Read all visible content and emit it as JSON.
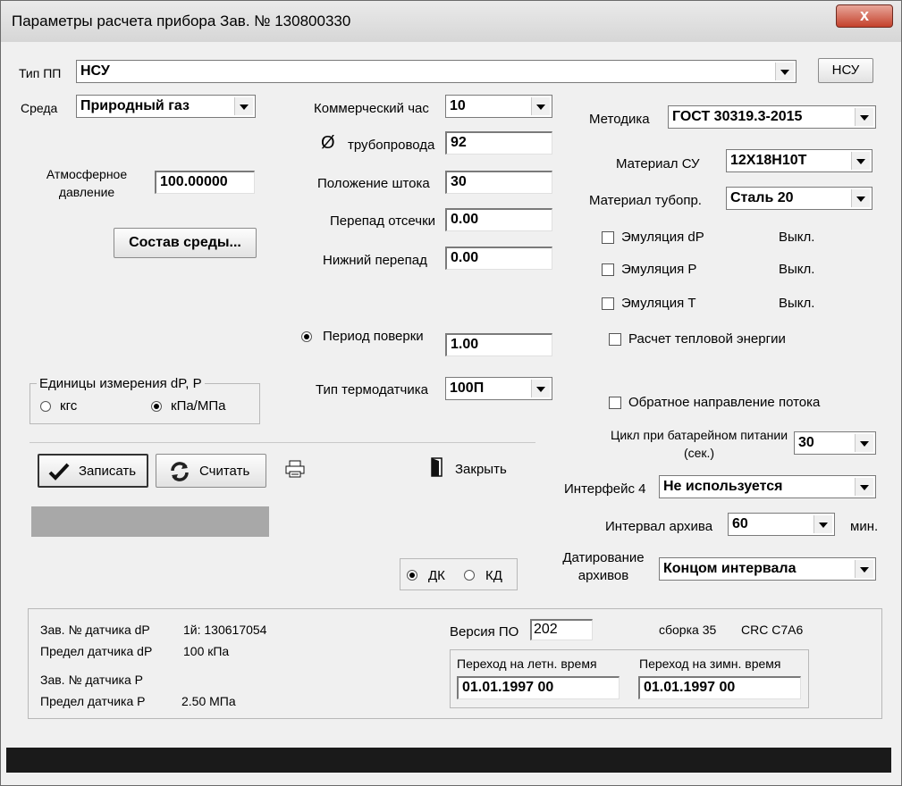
{
  "window": {
    "title": "Параметры расчета прибора  Зав. № 130800330",
    "close": "x"
  },
  "device_type": {
    "label": "Тип ПП",
    "value": "НСУ",
    "button": "НСУ"
  },
  "medium": {
    "label": "Среда",
    "value": "Природный газ"
  },
  "atm": {
    "label": "Атмосферное давление",
    "value": "100.00000"
  },
  "composition_button": "Состав среды...",
  "commercial_hour": {
    "label": "Коммерческий час",
    "value": "10"
  },
  "pipe": {
    "symbol": "Ø",
    "label": "трубопровода",
    "value": "92"
  },
  "stem": {
    "label": "Положение штока",
    "value": "30"
  },
  "cutoff": {
    "label": "Перепад отсечки",
    "value": "0.00"
  },
  "low_drop": {
    "label": "Нижний перепад",
    "value": "0.00"
  },
  "verification": {
    "label": "Период поверки",
    "value": "1.00"
  },
  "thermo": {
    "label": "Тип термодатчика",
    "value": "100П"
  },
  "units": {
    "legend": "Единицы измерения dP, P",
    "opt1": "кгс",
    "opt2": "кПа/МПа"
  },
  "method": {
    "label": "Методика",
    "value": "ГОСТ 30319.3-2015"
  },
  "su_material": {
    "label": "Материал СУ",
    "value": "12Х18Н10Т"
  },
  "pipe_material": {
    "label": "Материал тубопр.",
    "value": "Сталь 20"
  },
  "emulation": [
    {
      "label": "Эмуляция dP",
      "state": "Выкл."
    },
    {
      "label": "Эмуляция P",
      "state": "Выкл."
    },
    {
      "label": "Эмуляция T",
      "state": "Выкл."
    }
  ],
  "heat_energy": "Расчет тепловой энергии",
  "reverse_flow": "Обратное направление потока",
  "battery_cycle": {
    "label": "Цикл при батарейном питании (сек.)",
    "value": "30"
  },
  "interface4": {
    "label": "Интерфейс 4",
    "value": "Не используется"
  },
  "archive_interval": {
    "label": "Интервал архива",
    "value": "60",
    "unit": "мин."
  },
  "archive_dating": {
    "label": "Датирование архивов",
    "value": "Концом интервала"
  },
  "buttons": {
    "write": "Записать",
    "read": "Считать",
    "close": "Закрыть"
  },
  "mode": {
    "dk": "ДК",
    "kd": "КД"
  },
  "info": {
    "dp_serial_label": "Зав. № датчика dP",
    "dp_serial_value": "1й: 130617054",
    "dp_limit_label": "Предел датчика dP",
    "dp_limit_value": "100 кПа",
    "p_serial_label": "Зав. № датчика P",
    "p_limit_label": "Предел датчика P",
    "p_limit_value": "2.50 МПа",
    "fw_label": "Версия ПО",
    "fw_value": "202",
    "build": "сборка 35",
    "crc": "CRC C7A6",
    "summer_label": "Переход на летн. время",
    "summer_value": "01.01.1997 00",
    "winter_label": "Переход на зимн. время",
    "winter_value": "01.01.1997 00"
  },
  "colors": {
    "progress": "#a8a8a8",
    "statusbar": "#1a1a1a",
    "close_button": "#c4412c"
  }
}
